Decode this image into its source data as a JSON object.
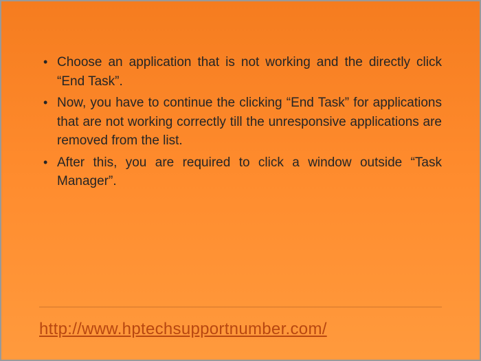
{
  "bullets": {
    "items": [
      {
        "text": "Choose an application that is not working and the directly click “End Task”."
      },
      {
        "text": "Now, you have to continue the clicking “End Task” for applications that are not working correctly till the unresponsive applications are removed from the list."
      },
      {
        "text": "After this, you are required to click a window outside “Task Manager”."
      }
    ]
  },
  "footer": {
    "url": "http://www.hptechsupportnumber.com/"
  }
}
